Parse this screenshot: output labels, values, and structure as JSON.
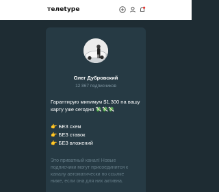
{
  "header": {
    "logo": "тeлetype",
    "icons": [
      "add-icon",
      "user-icon",
      "notification-bell-icon"
    ],
    "accent": "#e53935"
  },
  "channel": {
    "name": "Олег Дубровский",
    "subscribers": "12 867 подписчиков"
  },
  "post": {
    "line1": "Гарантирую минимум $1.300 на вашу",
    "line2": "карту уже сегодня 💸💸💸",
    "items": [
      {
        "emoji": "👉",
        "text": "БЕЗ схем"
      },
      {
        "emoji": "👉",
        "text": "БЕЗ ставок"
      },
      {
        "emoji": "👉",
        "text": "БЕЗ вложений"
      }
    ]
  },
  "notice": {
    "lines": [
      "Это приватный канал! Новые",
      "подписчики могут присоединится к",
      "каналу автоматически по ссылке",
      "ниже, если она для них активна."
    ]
  }
}
